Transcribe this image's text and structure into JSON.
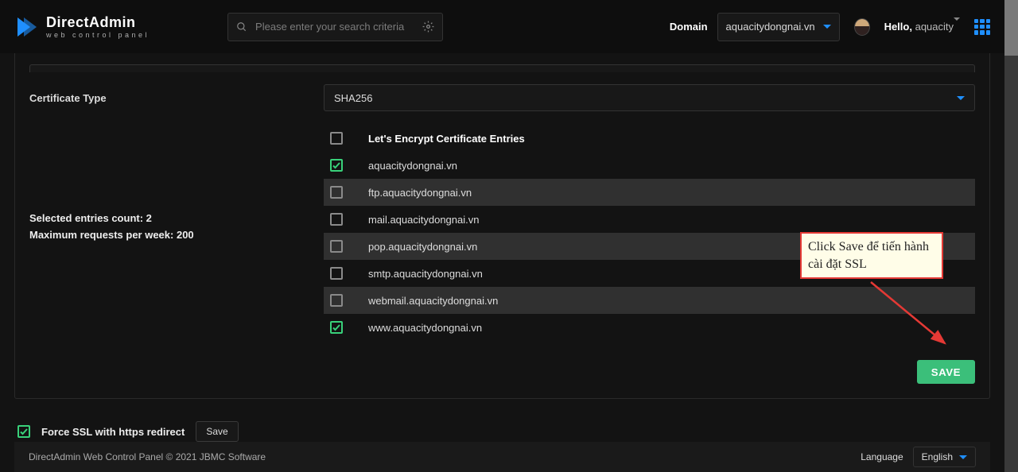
{
  "brand": {
    "title": "DirectAdmin",
    "subtitle": "web control panel"
  },
  "search": {
    "placeholder": "Please enter your search criteria"
  },
  "domain_label": "Domain",
  "domain_value": "aquacitydongnai.vn",
  "hello_prefix": "Hello,",
  "hello_user": "aquacity",
  "cert_type_label": "Certificate Type",
  "cert_type_value": "SHA256",
  "entries_header": "Let's Encrypt Certificate Entries",
  "entries": [
    {
      "label": "aquacitydongnai.vn",
      "checked": true
    },
    {
      "label": "ftp.aquacitydongnai.vn",
      "checked": false
    },
    {
      "label": "mail.aquacitydongnai.vn",
      "checked": false
    },
    {
      "label": "pop.aquacitydongnai.vn",
      "checked": false
    },
    {
      "label": "smtp.aquacitydongnai.vn",
      "checked": false
    },
    {
      "label": "webmail.aquacitydongnai.vn",
      "checked": false
    },
    {
      "label": "www.aquacitydongnai.vn",
      "checked": true
    }
  ],
  "selected_count_label": "Selected entries count: 2",
  "max_requests_label": "Maximum requests per week: 200",
  "save_label": "SAVE",
  "force_ssl_label": "Force SSL with https redirect",
  "force_ssl_checked": true,
  "mini_save_label": "Save",
  "footer_copy": "DirectAdmin Web Control Panel © 2021 JBMC Software",
  "language_label": "Language",
  "language_value": "English",
  "callout_text": "Click Save để tiến hành cài đặt SSL"
}
